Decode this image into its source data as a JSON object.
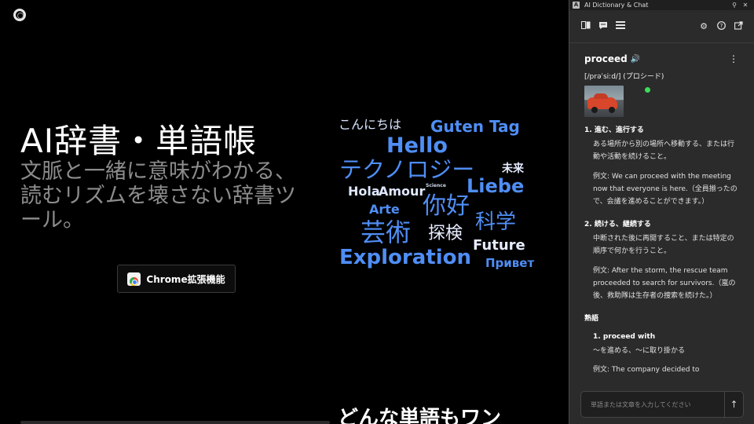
{
  "landing": {
    "title": "AI辞書・単語帳",
    "subtitle": "文脈と一緒に意味がわかる、読むリズムを壊さない辞書ツール。",
    "cta_label": "Chrome拡張機能",
    "bottom_title": "どんな単語もワン",
    "word_cloud": [
      {
        "text": "こんにちは",
        "color": "#d9e4ff"
      },
      {
        "text": "Guten Tag",
        "color": "#4f8ef5"
      },
      {
        "text": "Hello",
        "color": "#4f8ef5"
      },
      {
        "text": "テクノロジー",
        "color": "#4f8ef5"
      },
      {
        "text": "未来",
        "color": "#e6ecff"
      },
      {
        "text": "Science",
        "color": "#cfd8ea"
      },
      {
        "text": "Hola",
        "color": "#dfe7ff"
      },
      {
        "text": "Amour",
        "color": "#dfe7ff"
      },
      {
        "text": "Liebe",
        "color": "#4f8ef5"
      },
      {
        "text": "Arte",
        "color": "#4f8ef5"
      },
      {
        "text": "你好",
        "color": "#4f8ef5"
      },
      {
        "text": "科学",
        "color": "#4f8ef5"
      },
      {
        "text": "芸術",
        "color": "#4f8ef5"
      },
      {
        "text": "探検",
        "color": "#e6ecff"
      },
      {
        "text": "Future",
        "color": "#e6ecff"
      },
      {
        "text": "Exploration",
        "color": "#4f8ef5"
      },
      {
        "text": "Привет",
        "color": "#4f8ef5"
      }
    ]
  },
  "panel": {
    "window_title": "AI Dictionary & Chat",
    "app_badge": "A",
    "icons": {
      "pin": "pin-icon",
      "close": "close-icon",
      "book": "book-icon",
      "chat": "chat-icon",
      "list": "list-icon",
      "settings": "gear-icon",
      "help": "help-icon",
      "external": "external-link-icon"
    },
    "entry": {
      "word": "proceed",
      "phonetic": "[/prəˈsiːd/] (プロシード)",
      "senses": [
        {
          "title": "1. 進む、進行する",
          "definition": "ある場所から別の場所へ移動する、または行動や活動を続けること。",
          "example": "例文: We can proceed with the meeting now that everyone is here.（全員揃ったので、会議を進めることができます。）"
        },
        {
          "title": "2. 続ける、継続する",
          "definition": "中断された後に再開すること、または特定の順序で何かを行うこと。",
          "example": "例文: After the storm, the rescue team proceeded to search for survivors.（嵐の後、救助隊は生存者の捜索を続けた。）"
        }
      ],
      "idioms_title": "熟語",
      "phrases": [
        {
          "title": "1. proceed with",
          "definition": "〜を進める、〜に取り掛かる",
          "example": "例文: The company decided to"
        }
      ]
    },
    "input_placeholder": "単語または文章を入力してください"
  }
}
